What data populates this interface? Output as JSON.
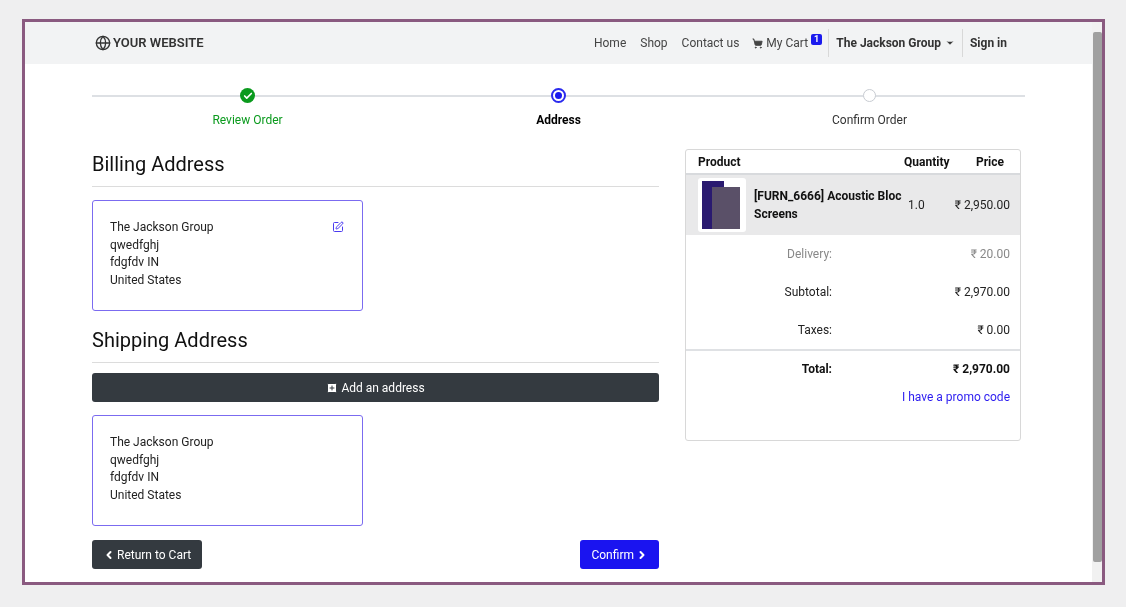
{
  "navbar": {
    "brand": "YOUR WEBSITE",
    "links": [
      {
        "label": "Home"
      },
      {
        "label": "Shop"
      },
      {
        "label": "Contact us"
      }
    ],
    "cart": {
      "label": "My Cart",
      "badge": "1"
    },
    "user": "The Jackson Group",
    "sign_in": "Sign in"
  },
  "steps": [
    {
      "label": "Review Order",
      "kind": "done"
    },
    {
      "label": "Address",
      "kind": "current"
    },
    {
      "label": "Confirm Order",
      "kind": "todo"
    }
  ],
  "billing": {
    "title": "Billing Address",
    "card": {
      "lines": [
        "The Jackson Group",
        "qwedfghj",
        "fdgfdv IN",
        "United States"
      ],
      "editable": true
    }
  },
  "shipping": {
    "title": "Shipping Address",
    "add_button": "Add an address",
    "cards": [
      {
        "lines": [
          "The Jackson Group",
          "qwedfghj",
          "fdgfdv IN",
          "United States"
        ],
        "editable": false
      }
    ]
  },
  "actions": {
    "back": "Return to Cart",
    "confirm": "Confirm"
  },
  "summary": {
    "columns": [
      "Product",
      "Quantity",
      "Price"
    ],
    "items": [
      {
        "name": "[FURN_6666] Acoustic Bloc Screens",
        "quantity": "1.0",
        "price": "₹ 2,950.00"
      }
    ],
    "totals": [
      {
        "label": "Delivery:",
        "value": "₹ 20.00",
        "kind": "muted"
      },
      {
        "label": "Subtotal:",
        "value": "₹ 2,970.00",
        "kind": "normal"
      },
      {
        "label": "Taxes:",
        "value": "₹ 0.00",
        "kind": "normal"
      },
      {
        "label": "Total:",
        "value": "₹ 2,970.00",
        "kind": "total"
      }
    ],
    "promo": "I have a promo code"
  }
}
